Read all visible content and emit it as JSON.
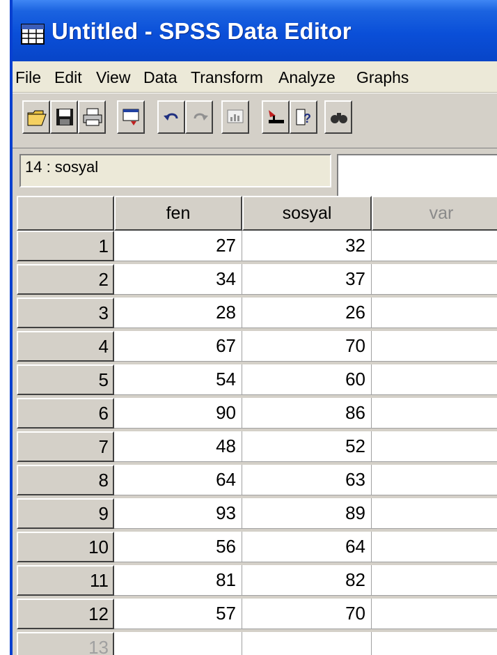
{
  "window": {
    "title": "Untitled - SPSS Data Editor",
    "app_icon": "spss-data-editor-icon",
    "titlebar_color": "#0a4fd8"
  },
  "menu": [
    "File",
    "Edit",
    "View",
    "Data",
    "Transform",
    "Analyze",
    "Graphs"
  ],
  "toolbar": {
    "buttons": [
      {
        "name": "open-file-icon"
      },
      {
        "name": "save-icon"
      },
      {
        "name": "print-icon"
      },
      {
        "name": "dialog-recall-icon"
      },
      {
        "name": "undo-icon"
      },
      {
        "name": "redo-icon"
      },
      {
        "name": "goto-chart-icon"
      },
      {
        "name": "goto-case-icon"
      },
      {
        "name": "variables-icon"
      },
      {
        "name": "find-icon"
      }
    ]
  },
  "cell_editor": {
    "reference": "14 : sosyal",
    "value": ""
  },
  "grid": {
    "columns": [
      "fen",
      "sosyal",
      "var"
    ],
    "rows": [
      {
        "n": "1",
        "fen": "27",
        "sosyal": "32"
      },
      {
        "n": "2",
        "fen": "34",
        "sosyal": "37"
      },
      {
        "n": "3",
        "fen": "28",
        "sosyal": "26"
      },
      {
        "n": "4",
        "fen": "67",
        "sosyal": "70"
      },
      {
        "n": "5",
        "fen": "54",
        "sosyal": "60"
      },
      {
        "n": "6",
        "fen": "90",
        "sosyal": "86"
      },
      {
        "n": "7",
        "fen": "48",
        "sosyal": "52"
      },
      {
        "n": "8",
        "fen": "64",
        "sosyal": "63"
      },
      {
        "n": "9",
        "fen": "93",
        "sosyal": "89"
      },
      {
        "n": "10",
        "fen": "56",
        "sosyal": "64"
      },
      {
        "n": "11",
        "fen": "81",
        "sosyal": "82"
      },
      {
        "n": "12",
        "fen": "57",
        "sosyal": "70"
      },
      {
        "n": "13",
        "fen": "",
        "sosyal": ""
      }
    ]
  }
}
